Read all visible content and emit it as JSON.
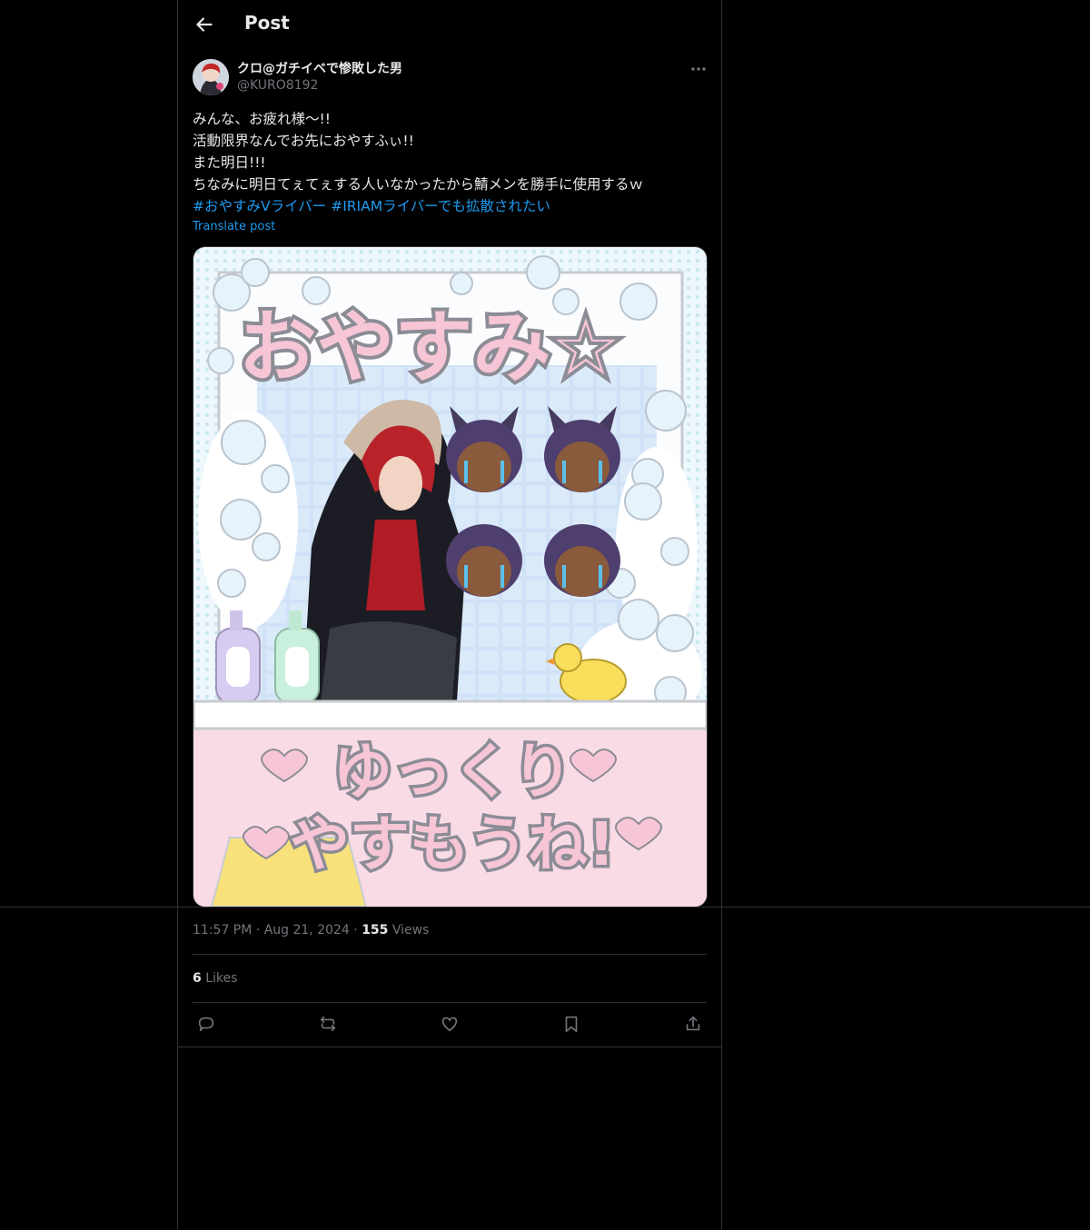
{
  "header": {
    "title": "Post"
  },
  "author": {
    "name": "クロ@ガチイベで惨敗した男",
    "handle": "@KURO8192"
  },
  "post": {
    "lines": [
      "みんな、お疲れ様〜!!",
      "活動限界なんでお先におやすふぃ!!",
      "また明日!!!",
      "ちなみに明日てぇてぇする人いなかったから鯖メンを勝手に使用するｗ"
    ],
    "hashtags": [
      "#おやすみVライバー",
      "#IRIAMライバーでも拡散されたい"
    ],
    "translate_label": "Translate post"
  },
  "image": {
    "top_text": "おやすみ☆",
    "bottom_line1": "ゆっくり",
    "bottom_line2": "やすもうね!"
  },
  "meta": {
    "time": "11:57 PM",
    "date": "Aug 21, 2024",
    "views_count": "155",
    "views_label": "Views",
    "likes_count": "6",
    "likes_label": "Likes"
  },
  "colors": {
    "accent": "#1d9bf0",
    "background": "#000000",
    "border": "#2f3336",
    "muted": "#71767b"
  }
}
